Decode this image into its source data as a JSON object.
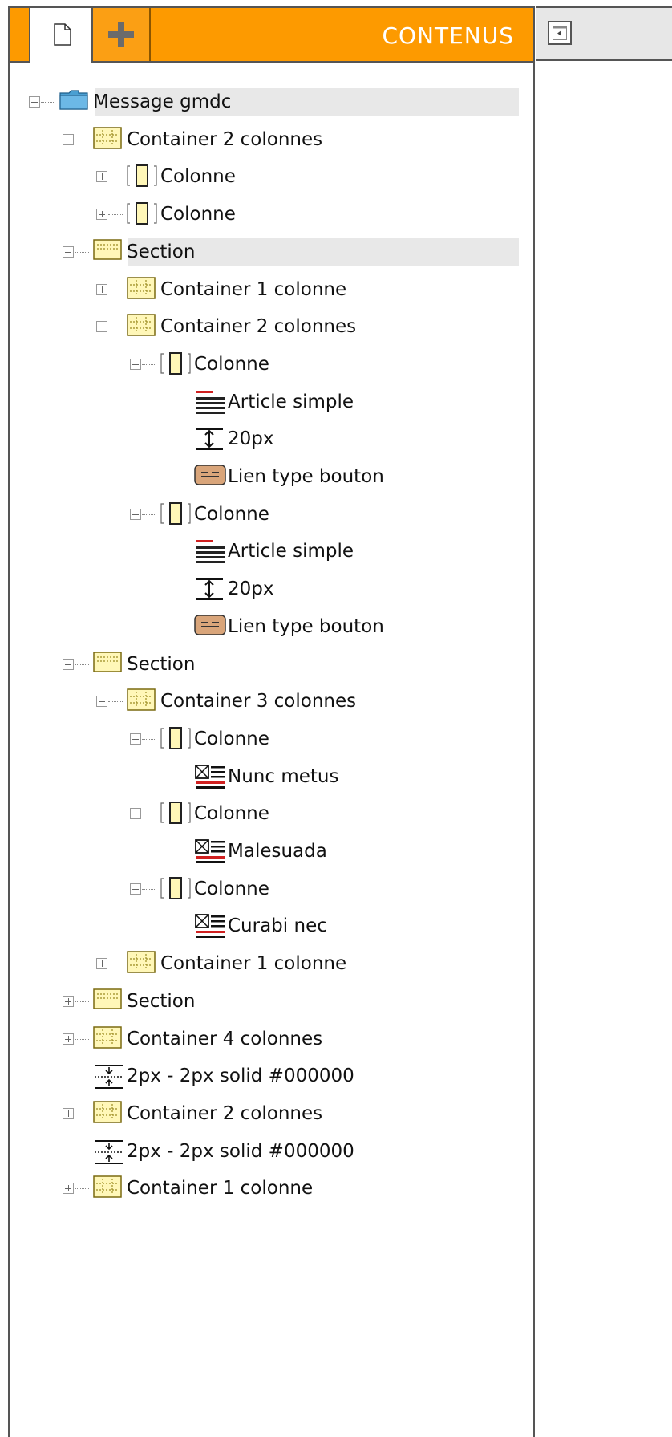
{
  "header": {
    "title": "CONTENUS",
    "tabs": [
      {
        "icon": "document-icon"
      },
      {
        "icon": "plus-icon"
      }
    ],
    "accent_color": "#fd9a00"
  },
  "side_panel": {
    "collapse_icon": "collapse-left-icon"
  },
  "tree": {
    "nodes": [
      {
        "label": "Message gmdc",
        "icon": "folder-icon",
        "expanded": true
      },
      {
        "label": "Container 2 colonnes",
        "icon": "container-icon",
        "expanded": true
      },
      {
        "label": "Colonne",
        "icon": "column-icon",
        "expanded": false
      },
      {
        "label": "Colonne",
        "icon": "column-icon",
        "expanded": false
      },
      {
        "label": "Section",
        "icon": "section-icon",
        "expanded": true
      },
      {
        "label": "Container 1 colonne",
        "icon": "container-icon",
        "expanded": false
      },
      {
        "label": "Container 2 colonnes",
        "icon": "container-icon",
        "expanded": true
      },
      {
        "label": "Colonne",
        "icon": "column-icon",
        "expanded": true
      },
      {
        "label": "Article simple",
        "icon": "article-icon"
      },
      {
        "label": "20px",
        "icon": "spacer-icon"
      },
      {
        "label": "Lien type bouton",
        "icon": "button-link-icon"
      },
      {
        "label": "Colonne",
        "icon": "column-icon",
        "expanded": true
      },
      {
        "label": "Article simple",
        "icon": "article-icon"
      },
      {
        "label": "20px",
        "icon": "spacer-icon"
      },
      {
        "label": "Lien type bouton",
        "icon": "button-link-icon"
      },
      {
        "label": "Section",
        "icon": "section-icon",
        "expanded": true
      },
      {
        "label": "Container 3 colonnes",
        "icon": "container-icon",
        "expanded": true
      },
      {
        "label": "Colonne",
        "icon": "column-icon",
        "expanded": true
      },
      {
        "label": "Nunc metus",
        "icon": "image-text-icon"
      },
      {
        "label": "Colonne",
        "icon": "column-icon",
        "expanded": true
      },
      {
        "label": "Malesuada",
        "icon": "image-text-icon"
      },
      {
        "label": "Colonne",
        "icon": "column-icon",
        "expanded": true
      },
      {
        "label": "Curabi nec",
        "icon": "image-text-icon"
      },
      {
        "label": "Container 1 colonne",
        "icon": "container-icon",
        "expanded": false
      },
      {
        "label": "Section",
        "icon": "section-icon",
        "expanded": false
      },
      {
        "label": "Container 4 colonnes",
        "icon": "container-icon",
        "expanded": false
      },
      {
        "label": "2px - 2px solid #000000",
        "icon": "divider-icon"
      },
      {
        "label": "Container 2 colonnes",
        "icon": "container-icon",
        "expanded": false
      },
      {
        "label": "2px - 2px solid #000000",
        "icon": "divider-icon"
      },
      {
        "label": "Container 1 colonne",
        "icon": "container-icon",
        "expanded": false
      }
    ]
  }
}
